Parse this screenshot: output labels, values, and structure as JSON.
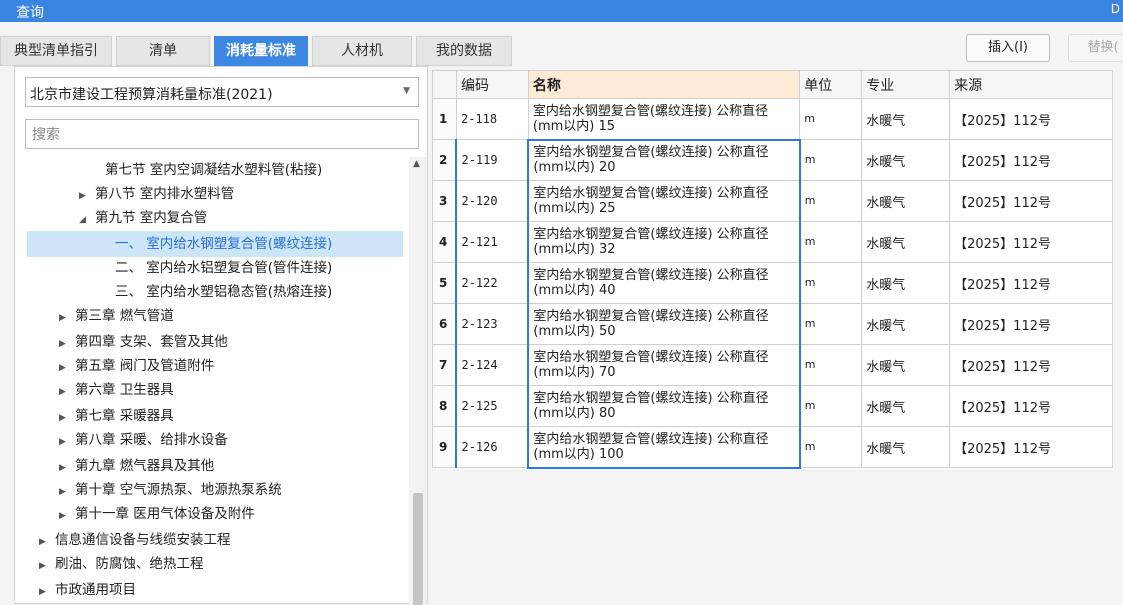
{
  "window": {
    "title": "查询",
    "edge_glyph": "D"
  },
  "tabs": [
    {
      "label": "典型清单指引"
    },
    {
      "label": "清单"
    },
    {
      "label": "消耗量标准",
      "active": true
    },
    {
      "label": "人材机"
    },
    {
      "label": "我的数据"
    }
  ],
  "buttons": {
    "insert": "插入(I)",
    "replace": "替换("
  },
  "standard_select": {
    "value": "北京市建设工程预算消耗量标准(2021)"
  },
  "search": {
    "placeholder": "搜索"
  },
  "tree": [
    {
      "label": "第七节 室内空调凝结水塑料管(粘接)",
      "toggle": ""
    },
    {
      "label": "第八节 室内排水塑料管",
      "toggle": "▶"
    },
    {
      "label": "第九节 室内复合管",
      "toggle": "◢"
    },
    {
      "label": "一、 室内给水钢塑复合管(螺纹连接)",
      "toggle": "",
      "selected": true
    },
    {
      "label": "二、 室内给水铝塑复合管(管件连接)",
      "toggle": ""
    },
    {
      "label": "三、 室内给水塑铝稳态管(热熔连接)",
      "toggle": ""
    },
    {
      "label": "第三章 燃气管道",
      "toggle": "▶"
    },
    {
      "label": "第四章 支架、套管及其他",
      "toggle": "▶"
    },
    {
      "label": "第五章 阀门及管道附件",
      "toggle": "▶"
    },
    {
      "label": "第六章 卫生器具",
      "toggle": "▶"
    },
    {
      "label": "第七章 采暖器具",
      "toggle": "▶"
    },
    {
      "label": "第八章 采暖、给排水设备",
      "toggle": "▶"
    },
    {
      "label": "第九章 燃气器具及其他",
      "toggle": "▶"
    },
    {
      "label": "第十章 空气源热泵、地源热泵系统",
      "toggle": "▶"
    },
    {
      "label": "第十一章 医用气体设备及附件",
      "toggle": "▶"
    },
    {
      "label": "信息通信设备与线缆安装工程",
      "toggle": "▶"
    },
    {
      "label": "刷油、防腐蚀、绝热工程",
      "toggle": "▶"
    },
    {
      "label": "市政通用项目",
      "toggle": "▶"
    }
  ],
  "table": {
    "headers": {
      "code": "编码",
      "name": "名称",
      "unit": "单位",
      "specialty": "专业",
      "source": "来源"
    },
    "rows": [
      {
        "index": "1",
        "code": "2-118",
        "name": "室内给水钢塑复合管(螺纹连接) 公称直径(mm以内) 15",
        "unit": "m",
        "specialty": "水暖气",
        "source": "【2025】112号"
      },
      {
        "index": "2",
        "code": "2-119",
        "name": "室内给水钢塑复合管(螺纹连接) 公称直径(mm以内) 20",
        "unit": "m",
        "specialty": "水暖气",
        "source": "【2025】112号"
      },
      {
        "index": "3",
        "code": "2-120",
        "name": "室内给水钢塑复合管(螺纹连接) 公称直径(mm以内) 25",
        "unit": "m",
        "specialty": "水暖气",
        "source": "【2025】112号"
      },
      {
        "index": "4",
        "code": "2-121",
        "name": "室内给水钢塑复合管(螺纹连接) 公称直径(mm以内) 32",
        "unit": "m",
        "specialty": "水暖气",
        "source": "【2025】112号"
      },
      {
        "index": "5",
        "code": "2-122",
        "name": "室内给水钢塑复合管(螺纹连接) 公称直径(mm以内) 40",
        "unit": "m",
        "specialty": "水暖气",
        "source": "【2025】112号"
      },
      {
        "index": "6",
        "code": "2-123",
        "name": "室内给水钢塑复合管(螺纹连接) 公称直径(mm以内) 50",
        "unit": "m",
        "specialty": "水暖气",
        "source": "【2025】112号"
      },
      {
        "index": "7",
        "code": "2-124",
        "name": "室内给水钢塑复合管(螺纹连接) 公称直径(mm以内) 70",
        "unit": "m",
        "specialty": "水暖气",
        "source": "【2025】112号"
      },
      {
        "index": "8",
        "code": "2-125",
        "name": "室内给水钢塑复合管(螺纹连接) 公称直径(mm以内) 80",
        "unit": "m",
        "specialty": "水暖气",
        "source": "【2025】112号"
      },
      {
        "index": "9",
        "code": "2-126",
        "name": "室内给水钢塑复合管(螺纹连接) 公称直径(mm以内) 100",
        "unit": "m",
        "specialty": "水暖气",
        "source": "【2025】112号"
      }
    ]
  },
  "colors": {
    "accent": "#3d87e3",
    "selection_border": "#2f77e0",
    "tree_selected_bg": "#cde6f7",
    "header_highlight": "#fdebd6"
  }
}
